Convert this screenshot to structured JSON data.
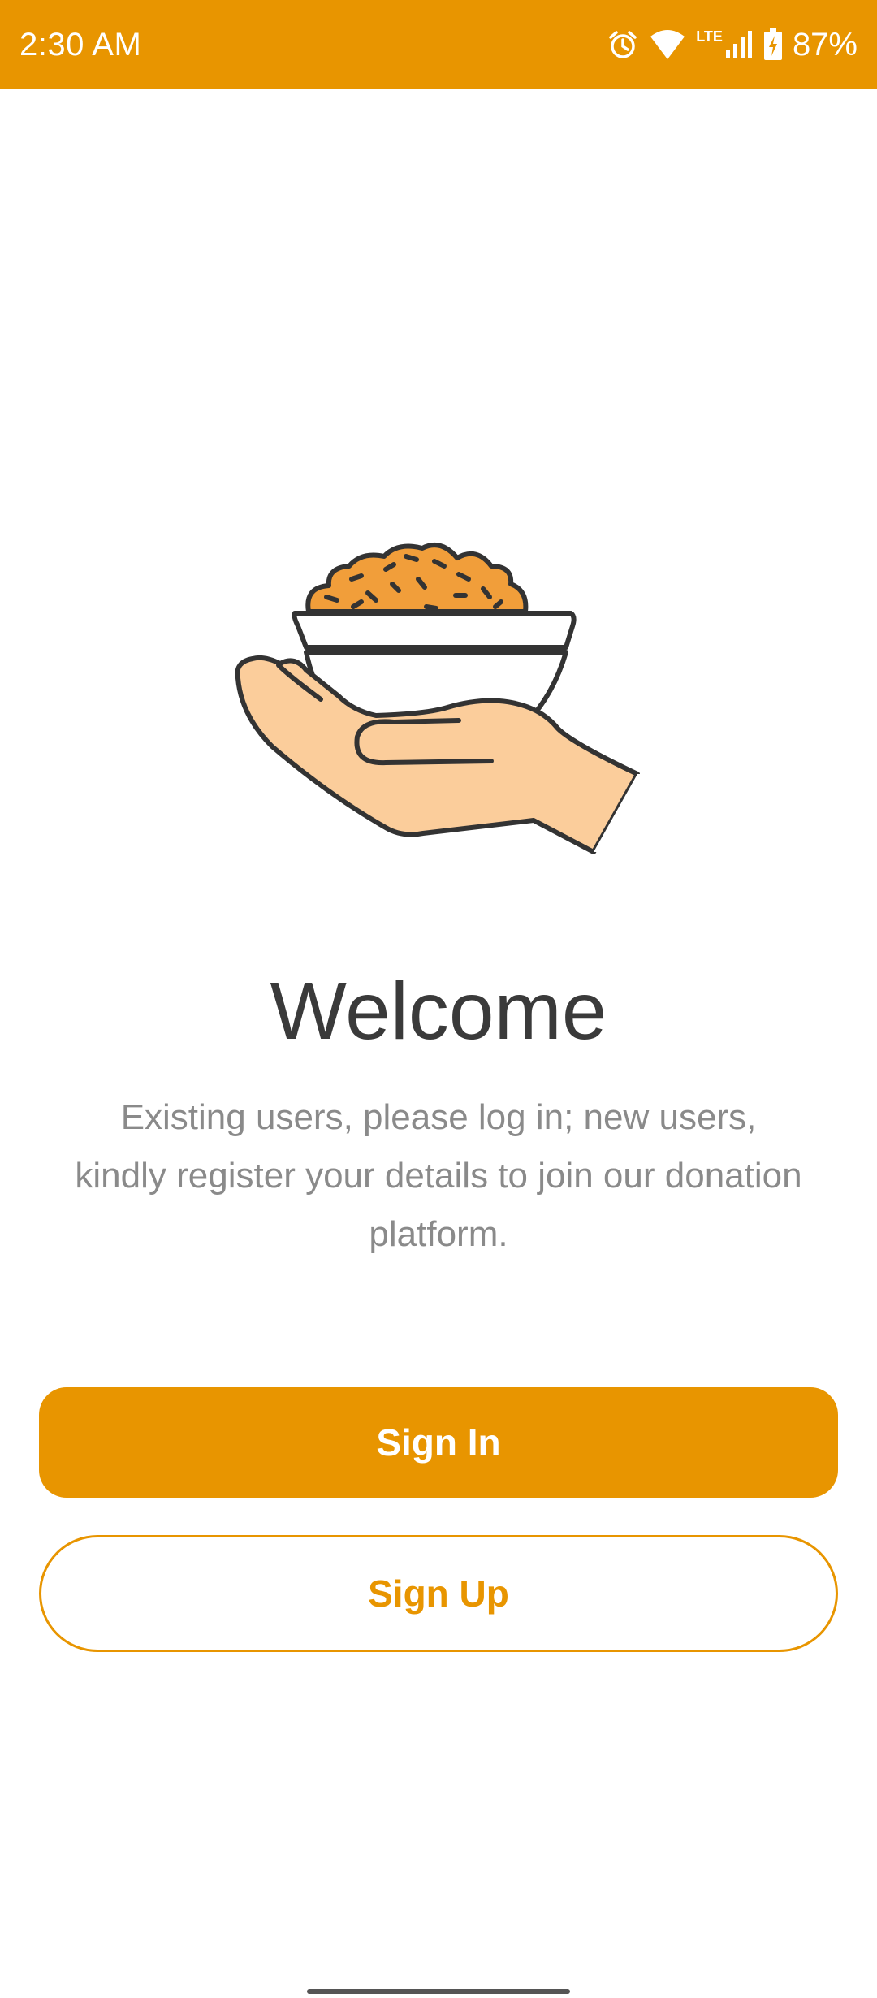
{
  "status_bar": {
    "time": "2:30 AM",
    "network_label": "LTE",
    "battery_percent": "87%",
    "icons": [
      "alarm-icon",
      "wifi-icon",
      "signal-icon",
      "battery-charging-icon"
    ],
    "background_color": "#E89500"
  },
  "illustration": {
    "icon": "hand-holding-food-bowl-icon"
  },
  "welcome": {
    "title": "Welcome",
    "description": "Existing users, please log in; new users, kindly register your details to join our donation platform."
  },
  "actions": {
    "sign_in_label": "Sign In",
    "sign_up_label": "Sign Up",
    "accent_color": "#E89500"
  }
}
